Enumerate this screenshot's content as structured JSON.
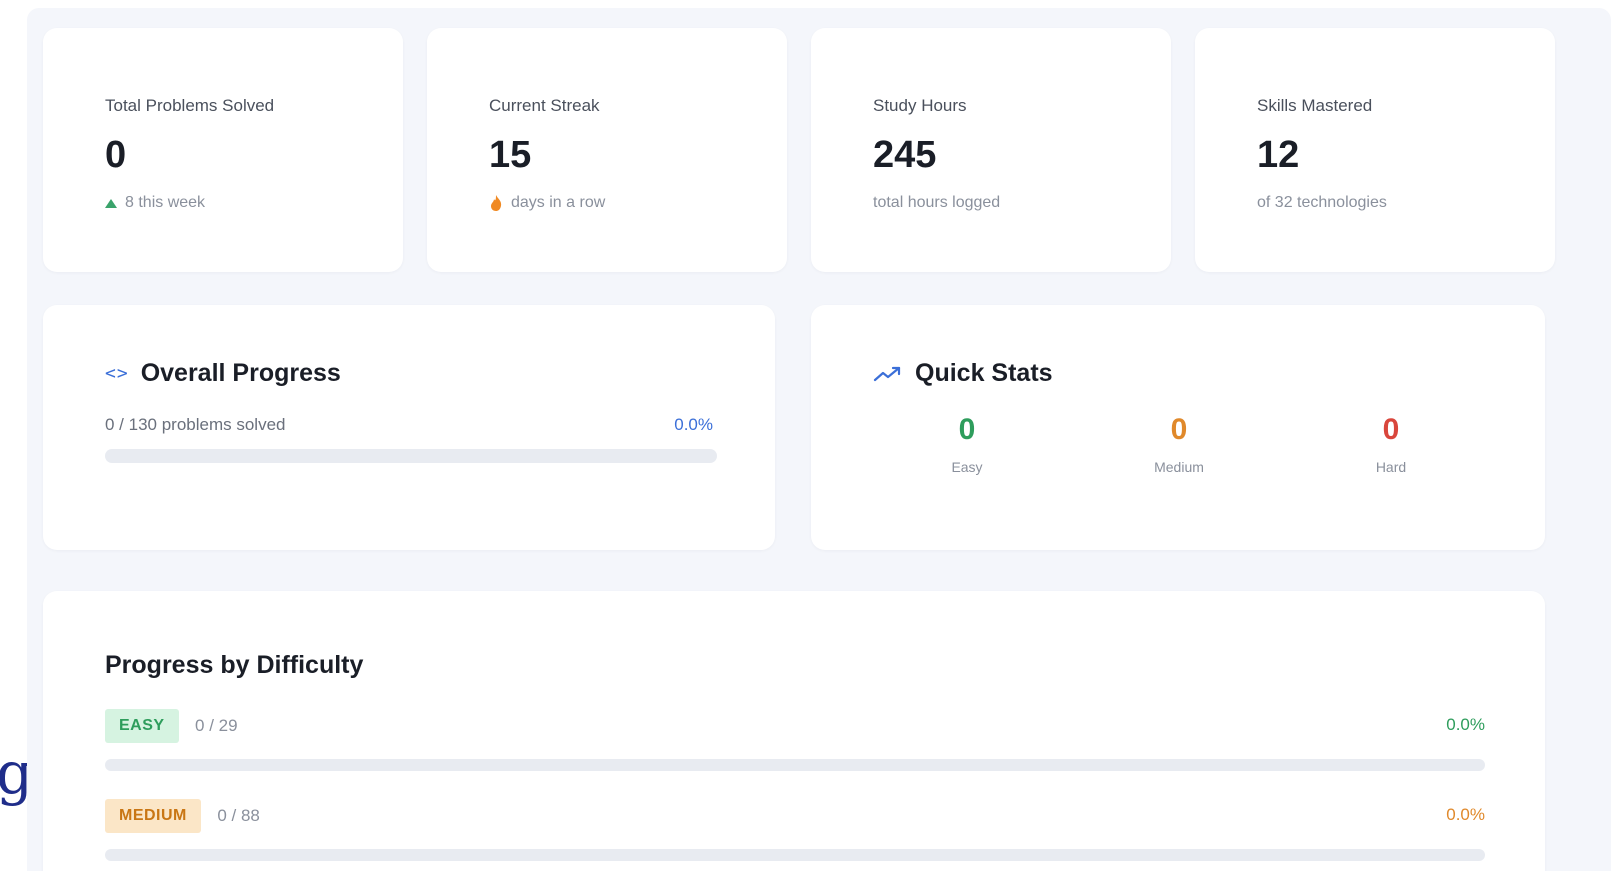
{
  "colors": {
    "accent_blue": "#3b6fd8",
    "easy_green": "#2e9d5c",
    "medium_orange": "#e0892b",
    "hard_red": "#d9463c",
    "easy_badge_bg": "#d6f3e1",
    "medium_badge_bg": "#fbe6c7",
    "up_green": "#3aa36b",
    "fire_orange": "#f08a24"
  },
  "left_fragment": {
    "glyph": "g"
  },
  "stats": [
    {
      "label": "Total Problems Solved",
      "value": "0",
      "sub": "8 this week",
      "icon": "trend-up-icon"
    },
    {
      "label": "Current Streak",
      "value": "15",
      "sub": "days in a row",
      "icon": "fire-icon"
    },
    {
      "label": "Study Hours",
      "value": "245",
      "sub": "total hours logged"
    },
    {
      "label": "Skills Mastered",
      "value": "12",
      "sub": "of 32 technologies"
    }
  ],
  "overall_progress": {
    "title": "Overall Progress",
    "icon": "code-icon",
    "code_glyph": "<>",
    "summary": "0 / 130 problems solved",
    "percent_text": "0.0%",
    "progress_fraction": 0
  },
  "quick_stats": {
    "title": "Quick Stats",
    "icon": "trending-line-icon",
    "items": [
      {
        "value": "0",
        "label": "Easy"
      },
      {
        "value": "0",
        "label": "Medium"
      },
      {
        "value": "0",
        "label": "Hard"
      }
    ]
  },
  "difficulty": {
    "title": "Progress by Difficulty",
    "rows": [
      {
        "badge": "EASY",
        "count": "0 / 29",
        "percent_text": "0.0%",
        "progress_fraction": 0
      },
      {
        "badge": "MEDIUM",
        "count": "0 / 88",
        "percent_text": "0.0%",
        "progress_fraction": 0
      }
    ]
  }
}
